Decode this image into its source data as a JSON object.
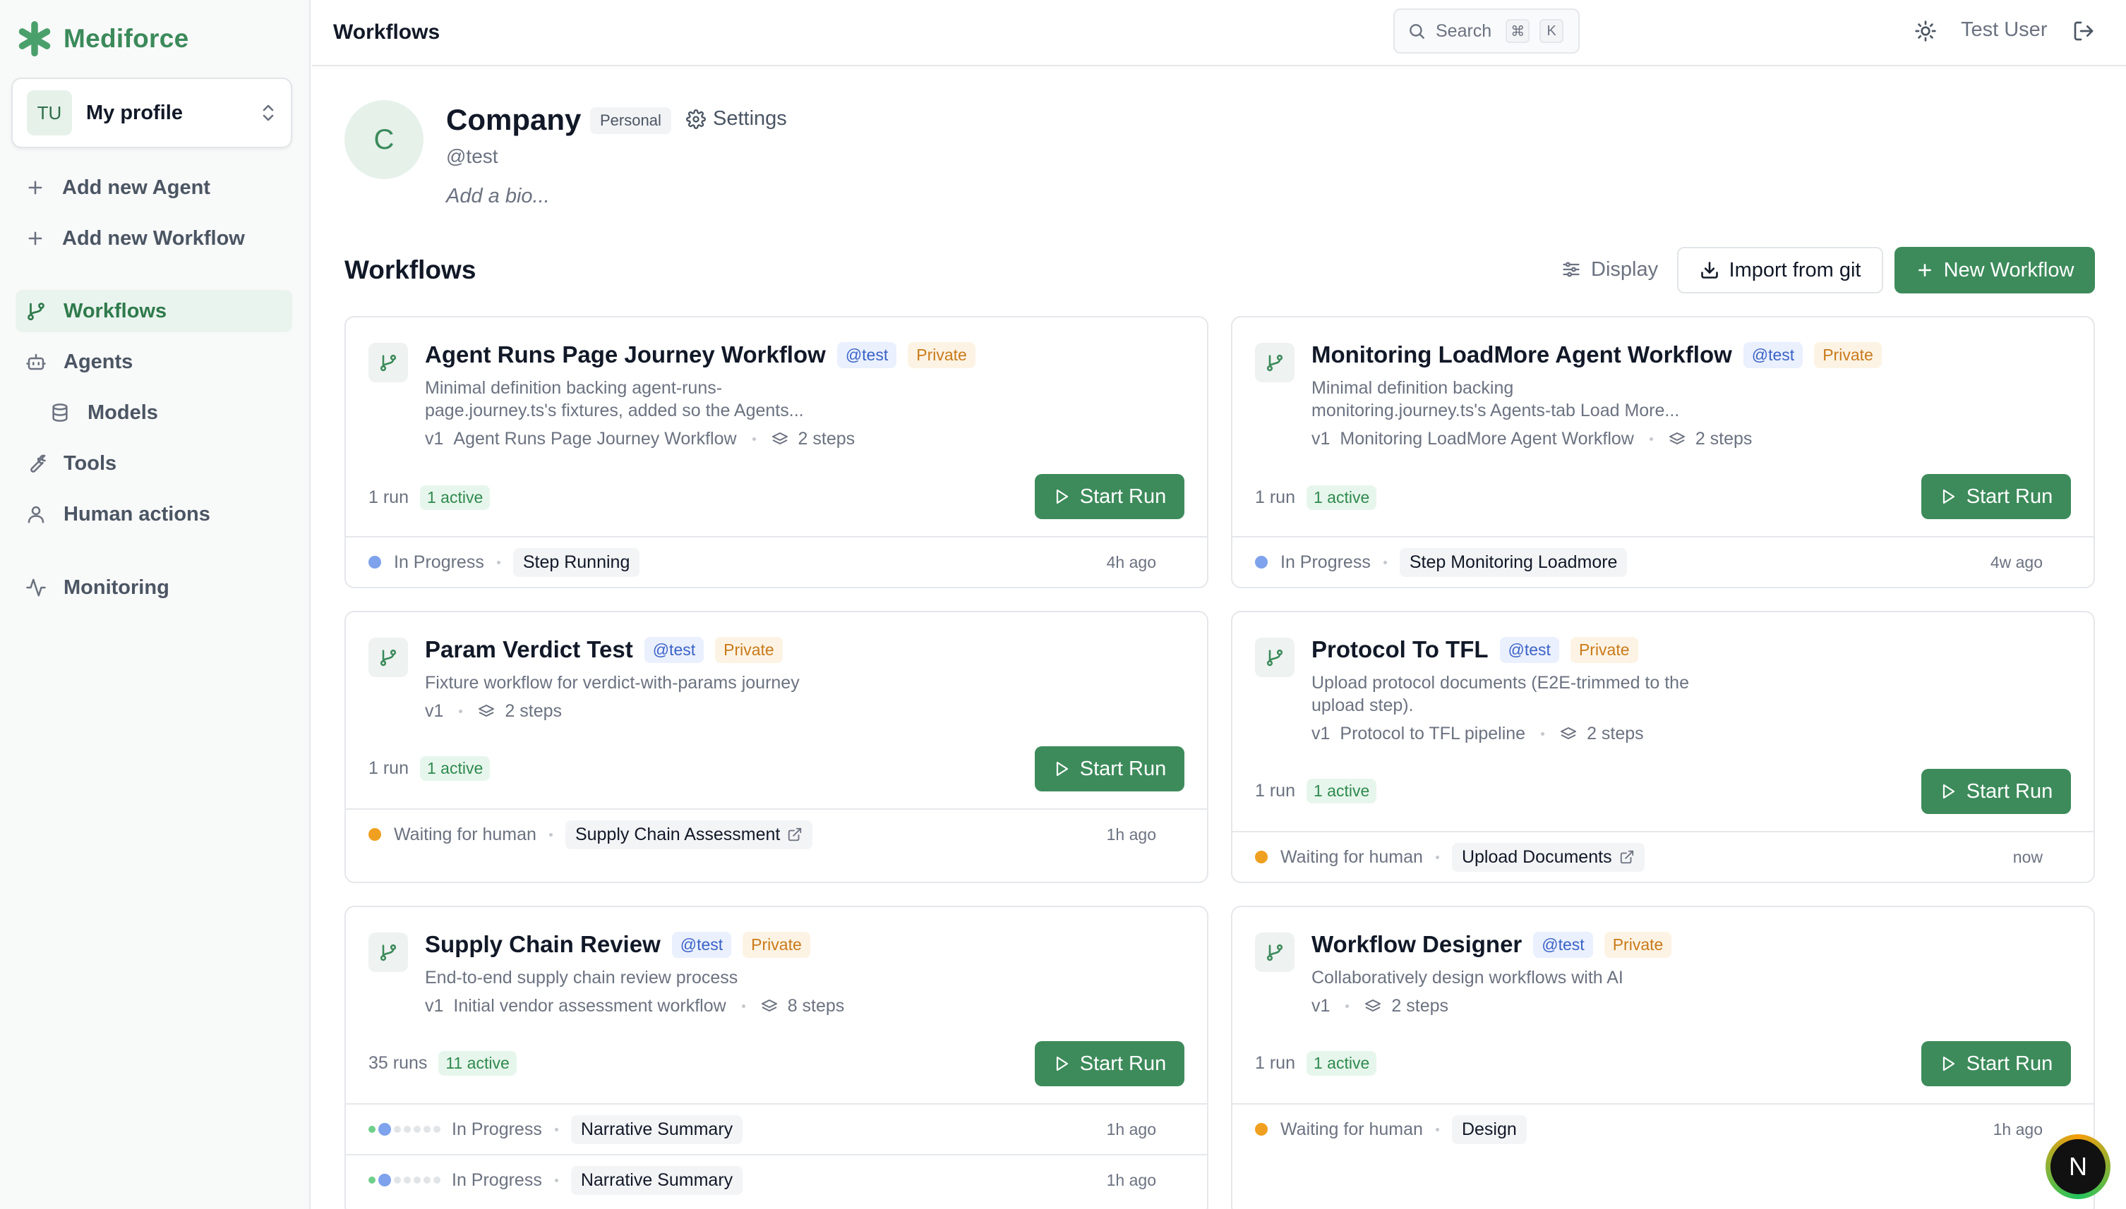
{
  "brand": {
    "name": "Mediforce"
  },
  "profile_switcher": {
    "initials": "TU",
    "label": "My profile"
  },
  "sidebar": {
    "actions": [
      {
        "label": "Add new Agent",
        "icon": "plus-icon"
      },
      {
        "label": "Add new Workflow",
        "icon": "plus-icon"
      }
    ],
    "nav": [
      {
        "label": "Workflows",
        "icon": "git-branch-icon",
        "active": true
      },
      {
        "label": "Agents",
        "icon": "bot-icon",
        "active": false
      },
      {
        "label": "Models",
        "icon": "database-icon",
        "active": false,
        "sub": true
      },
      {
        "label": "Tools",
        "icon": "wrench-icon",
        "active": false
      },
      {
        "label": "Human actions",
        "icon": "user-icon",
        "active": false
      },
      {
        "label": "Monitoring",
        "icon": "activity-icon",
        "active": false
      }
    ]
  },
  "topbar": {
    "title": "Workflows",
    "search_placeholder": "Search",
    "shortcut_mod": "⌘",
    "shortcut_key": "K",
    "user_name": "Test User"
  },
  "company": {
    "initial": "C",
    "name": "Company",
    "badge": "Personal",
    "settings_label": "Settings",
    "handle": "@test",
    "bio_placeholder": "Add a bio..."
  },
  "workflows_section": {
    "title": "Workflows",
    "display_label": "Display",
    "import_label": "Import from git",
    "new_label": "New Workflow"
  },
  "cards": [
    {
      "title": "Agent Runs Page Journey Workflow",
      "handle": "@test",
      "visibility": "Private",
      "desc": [
        "Minimal definition backing agent-runs-",
        "page.journey.ts's fixtures, added so the Agents..."
      ],
      "version": "v1",
      "version_name": "Agent Runs Page Journey Workflow",
      "steps": "2 steps",
      "runs": "1 run",
      "active": "1 active",
      "start_label": "Start Run",
      "rows": [
        {
          "status": "In Progress",
          "step": "Step Running",
          "time": "4h ago",
          "dot": "#7ea2ec",
          "link": false
        }
      ]
    },
    {
      "title": "Monitoring LoadMore Agent Workflow",
      "handle": "@test",
      "visibility": "Private",
      "desc": [
        "Minimal definition backing",
        "monitoring.journey.ts's Agents-tab Load More..."
      ],
      "version": "v1",
      "version_name": "Monitoring LoadMore Agent Workflow",
      "steps": "2 steps",
      "runs": "1 run",
      "active": "1 active",
      "start_label": "Start Run",
      "rows": [
        {
          "status": "In Progress",
          "step": "Step Monitoring Loadmore",
          "time": "4w ago",
          "dot": "#7ea2ec",
          "link": false
        }
      ]
    },
    {
      "title": "Param Verdict Test",
      "handle": "@test",
      "visibility": "Private",
      "desc": [
        "Fixture workflow for verdict-with-params journey"
      ],
      "version": "v1",
      "version_name": "",
      "steps": "2 steps",
      "runs": "1 run",
      "active": "1 active",
      "start_label": "Start Run",
      "rows": [
        {
          "status": "Waiting for human",
          "step": "Supply Chain Assessment",
          "time": "1h ago",
          "dot": "#f0a020",
          "link": true
        }
      ]
    },
    {
      "title": "Protocol To TFL",
      "handle": "@test",
      "visibility": "Private",
      "desc": [
        "Upload protocol documents (E2E-trimmed to the",
        "upload step)."
      ],
      "version": "v1",
      "version_name": "Protocol to TFL pipeline",
      "steps": "2 steps",
      "runs": "1 run",
      "active": "1 active",
      "start_label": "Start Run",
      "rows": [
        {
          "status": "Waiting for human",
          "step": "Upload Documents",
          "time": "now",
          "dot": "#f0a020",
          "link": true
        }
      ]
    },
    {
      "title": "Supply Chain Review",
      "handle": "@test",
      "visibility": "Private",
      "desc": [
        "End-to-end supply chain review process"
      ],
      "version": "v1",
      "version_name": "Initial vendor assessment workflow",
      "steps": "8 steps",
      "runs": "35 runs",
      "active": "11 active",
      "start_label": "Start Run",
      "rows": [
        {
          "status": "In Progress",
          "step": "Narrative Summary",
          "time": "1h ago",
          "dot": "multi",
          "link": false
        },
        {
          "status": "In Progress",
          "step": "Narrative Summary",
          "time": "1h ago",
          "dot": "multi",
          "link": false
        }
      ]
    },
    {
      "title": "Workflow Designer",
      "handle": "@test",
      "visibility": "Private",
      "desc": [
        "Collaboratively design workflows with AI"
      ],
      "version": "v1",
      "version_name": "",
      "steps": "2 steps",
      "runs": "1 run",
      "active": "1 active",
      "start_label": "Start Run",
      "rows": [
        {
          "status": "Waiting for human",
          "step": "Design",
          "time": "1h ago",
          "dot": "#f0a020",
          "link": false
        }
      ]
    }
  ],
  "floating_button": {
    "letter": "N"
  },
  "colors": {
    "brand": "#3b8a5a",
    "primary_button": "#3d8b5b",
    "in_progress": "#7ea2ec",
    "waiting": "#f0a020"
  }
}
